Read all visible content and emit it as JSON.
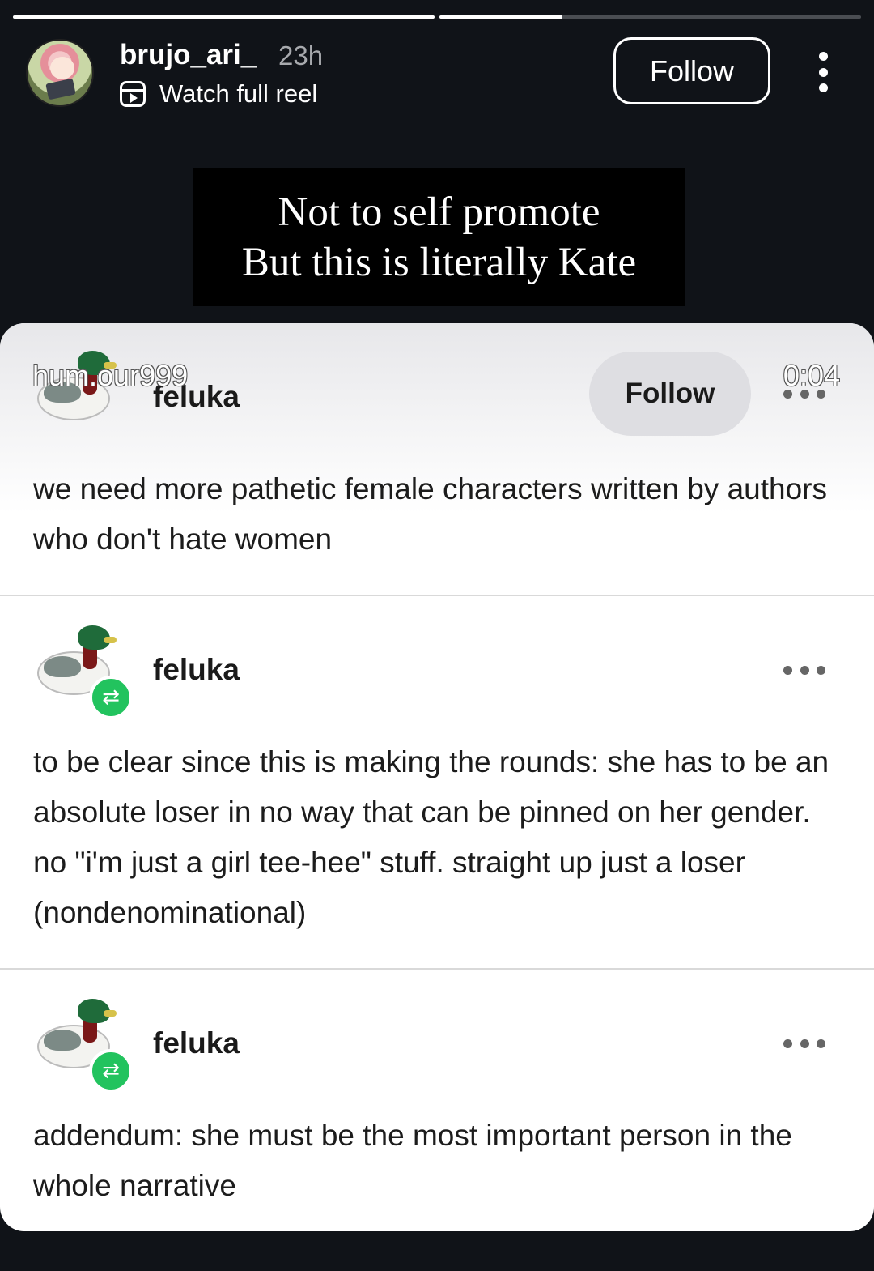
{
  "story": {
    "progress": [
      1.0,
      0.29
    ]
  },
  "header": {
    "username": "brujo_ari_",
    "time": "23h",
    "reel_link": "Watch full reel",
    "follow_label": "Follow"
  },
  "caption": {
    "line1": "Not to self promote",
    "line2": "But this is literally Kate"
  },
  "video": {
    "watermark": "hum.our999",
    "timer": "0:04",
    "follow_label": "Follow"
  },
  "posts": [
    {
      "author": "feluka",
      "text": "we need more pathetic female characters written by authors who don't hate women"
    },
    {
      "author": "feluka",
      "text": "to be clear since this is making the rounds: she has to be an absolute loser in no way that can be pinned on her gender. no \"i'm just a girl tee-hee\" stuff. straight up just a loser (nondenominational)"
    },
    {
      "author": "feluka",
      "text": "addendum: she must be the most important person in the whole narrative"
    }
  ]
}
